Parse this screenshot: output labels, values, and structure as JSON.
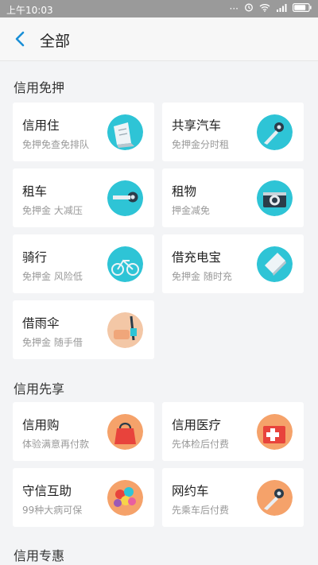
{
  "status_bar": {
    "time": "上午10:03"
  },
  "header": {
    "title": "全部"
  },
  "sections": [
    {
      "title": "信用免押",
      "cards": [
        {
          "title": "信用住",
          "subtitle": "免押免查免排队",
          "icon": "hotel-icon"
        },
        {
          "title": "共享汽车",
          "subtitle": "免押金分时租",
          "icon": "car-key-icon"
        },
        {
          "title": "租车",
          "subtitle": "免押金 大减压",
          "icon": "car-rental-key-icon"
        },
        {
          "title": "租物",
          "subtitle": "押金减免",
          "icon": "camera-icon"
        },
        {
          "title": "骑行",
          "subtitle": "免押金 风险低",
          "icon": "bicycle-icon"
        },
        {
          "title": "借充电宝",
          "subtitle": "免押金 随时充",
          "icon": "power-bank-icon"
        },
        {
          "title": "借雨伞",
          "subtitle": "免押金 随手借",
          "icon": "umbrella-icon"
        }
      ]
    },
    {
      "title": "信用先享",
      "cards": [
        {
          "title": "信用购",
          "subtitle": "体验满意再付款",
          "icon": "shopping-bag-icon"
        },
        {
          "title": "信用医疗",
          "subtitle": "先体检后付费",
          "icon": "medical-kit-icon"
        },
        {
          "title": "守信互助",
          "subtitle": "99种大病可保",
          "icon": "balloons-icon"
        },
        {
          "title": "网约车",
          "subtitle": "先乘车后付费",
          "icon": "car-key-icon"
        }
      ]
    },
    {
      "title": "信用专惠",
      "cards": []
    }
  ],
  "colors": {
    "cyan": "#2ec4d6",
    "orange": "#f5a26a",
    "red": "#e8433c"
  }
}
